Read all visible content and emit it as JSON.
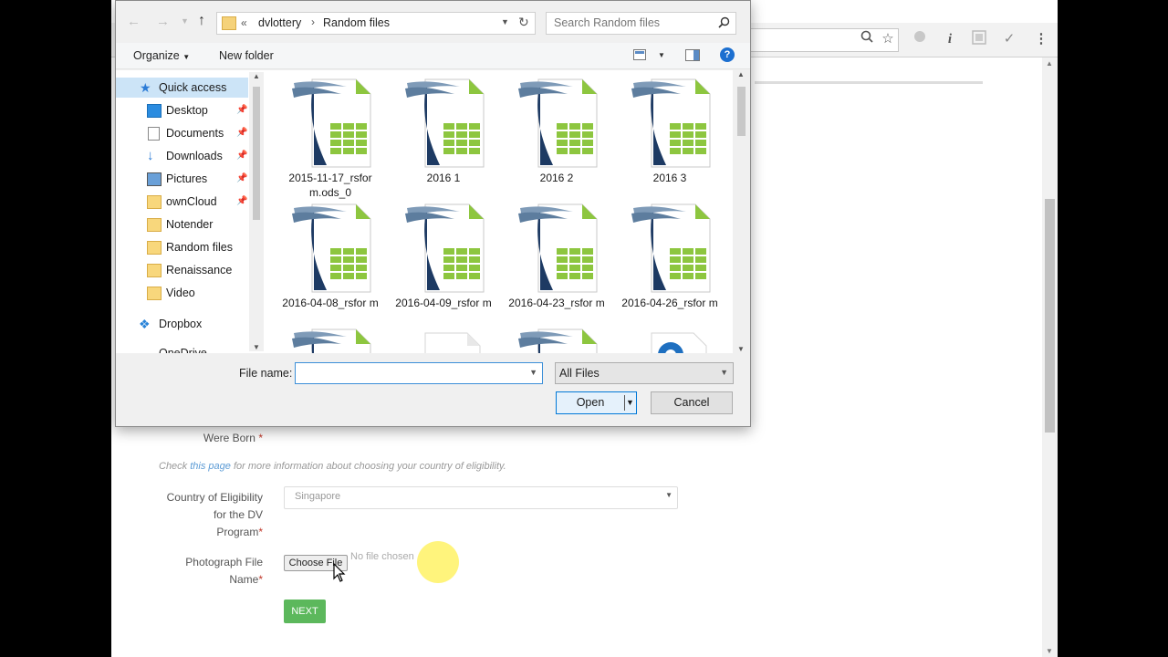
{
  "browser": {
    "toolbar_icons": [
      "zoom-icon",
      "star-icon",
      "extension-circle-icon",
      "info-icon",
      "extension-square-icon",
      "check-icon",
      "menu-dots-icon"
    ]
  },
  "form": {
    "born_label_line": "Were Born",
    "check_text_pre": "Check ",
    "check_link": "this page",
    "check_text_post": " for more information about choosing your country of eligibility.",
    "country_label_1": "Country of Eligibility",
    "country_label_2": "for the DV",
    "country_label_3": "Program",
    "country_value": "Singapore",
    "photo_label_1": "Photograph File",
    "photo_label_2": "Name",
    "choose_file": "Choose File",
    "no_file": "No file chosen",
    "next": "NEXT",
    "required_mark": "*"
  },
  "dialog": {
    "breadcrumb_prefix": "«",
    "breadcrumb": [
      "dvlottery",
      "Random files"
    ],
    "search_placeholder": "Search Random files",
    "organize": "Organize",
    "new_folder": "New folder",
    "nav_items": [
      {
        "label": "Quick access",
        "icon": "star-icon",
        "pinned": false
      },
      {
        "label": "Desktop",
        "icon": "desktop-icon",
        "pinned": true
      },
      {
        "label": "Documents",
        "icon": "documents-icon",
        "pinned": true
      },
      {
        "label": "Downloads",
        "icon": "downloads-icon",
        "pinned": true
      },
      {
        "label": "Pictures",
        "icon": "pictures-icon",
        "pinned": true
      },
      {
        "label": "ownCloud",
        "icon": "folder-icon",
        "pinned": true
      },
      {
        "label": "Notender",
        "icon": "folder-icon",
        "pinned": false
      },
      {
        "label": "Random files",
        "icon": "folder-icon",
        "pinned": false
      },
      {
        "label": "Renaissance",
        "icon": "folder-icon",
        "pinned": false
      },
      {
        "label": "Video",
        "icon": "folder-icon",
        "pinned": false
      },
      {
        "label": "Dropbox",
        "icon": "dropbox-icon",
        "pinned": false
      },
      {
        "label": "OneDrive",
        "icon": "onedrive-icon",
        "pinned": false
      }
    ],
    "files": [
      {
        "name": "2015-11-17_rsfor m.ods_0"
      },
      {
        "name": "2016 1"
      },
      {
        "name": "2016 2"
      },
      {
        "name": "2016 3"
      },
      {
        "name": "2016-04-08_rsfor m"
      },
      {
        "name": "2016-04-09_rsfor m"
      },
      {
        "name": "2016-04-23_rsfor m"
      },
      {
        "name": "2016-04-26_rsfor m"
      }
    ],
    "filename_label": "File name:",
    "filename_value": "",
    "filetype_value": "All Files",
    "open": "Open",
    "cancel": "Cancel"
  },
  "colors": {
    "accent": "#0078d7",
    "next_green": "#5cb85c",
    "link": "#5b9bd5"
  }
}
